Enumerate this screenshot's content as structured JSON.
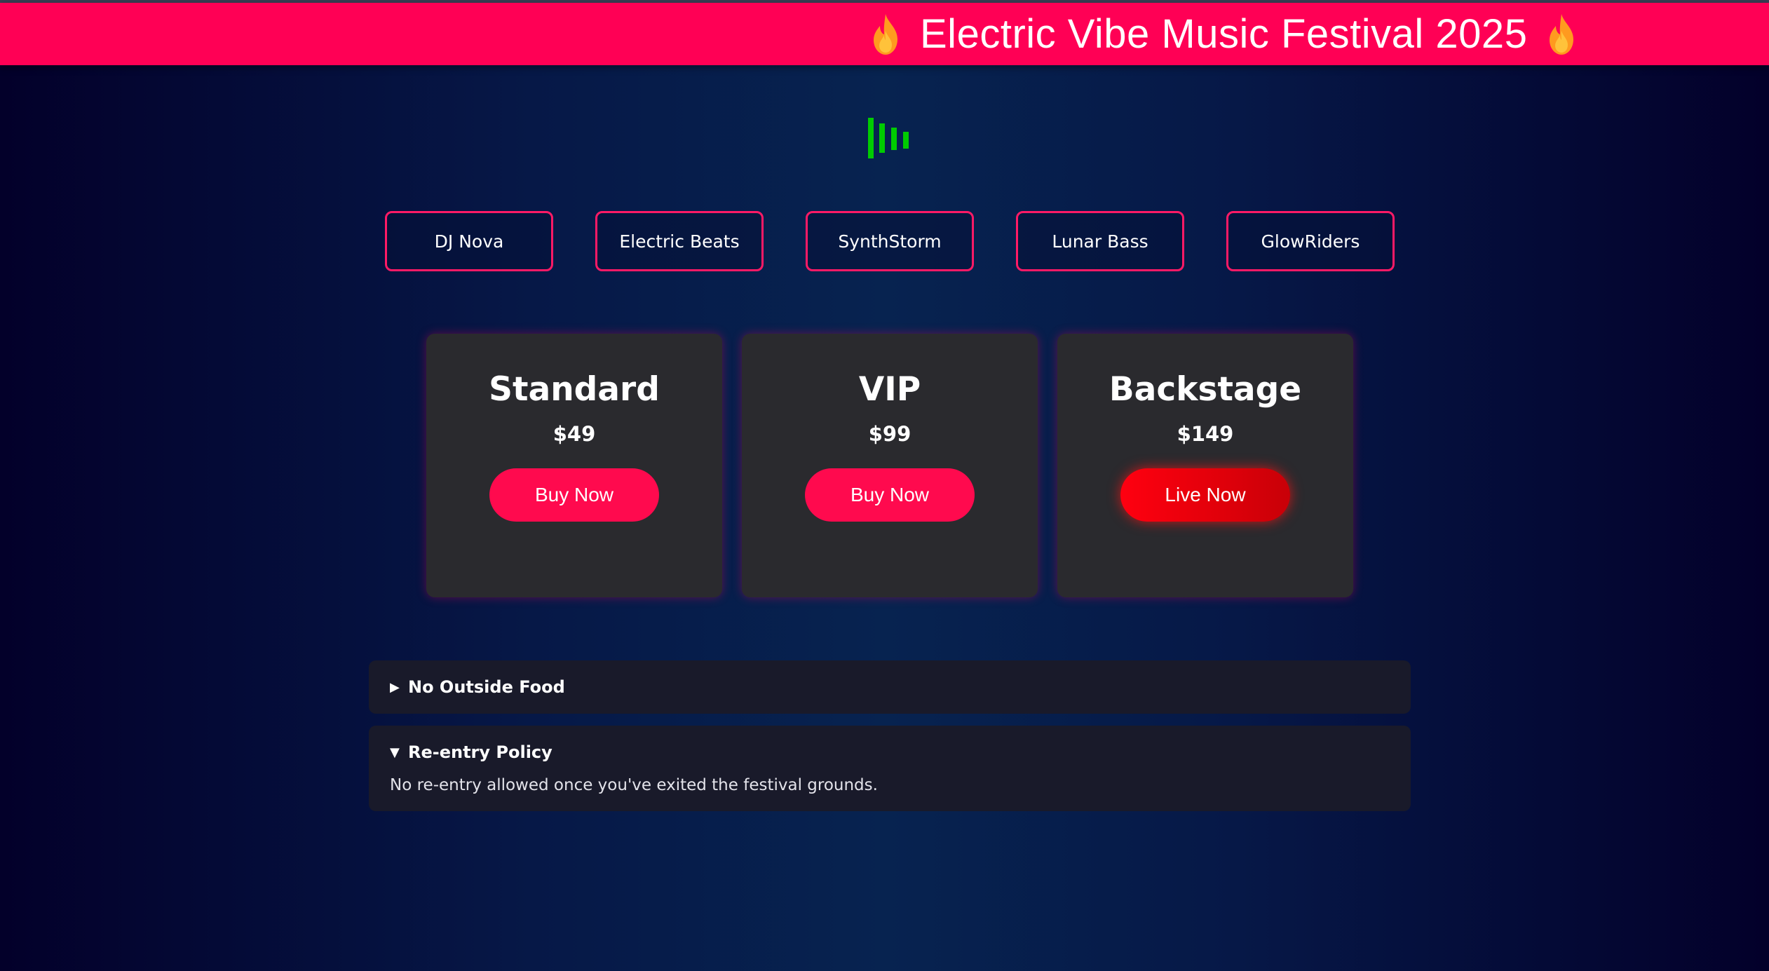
{
  "header": {
    "title": "Electric Vibe Music Festival 2025",
    "left_icon": "fire-icon",
    "right_icon": "fire-icon"
  },
  "visualizer": {
    "icon": "equalizer-icon",
    "color": "#00cc00"
  },
  "artists": [
    "DJ Nova",
    "Electric Beats",
    "SynthStorm",
    "Lunar Bass",
    "GlowRiders"
  ],
  "tickets": [
    {
      "name": "Standard",
      "price": "$49",
      "button": "Buy Now"
    },
    {
      "name": "VIP",
      "price": "$99",
      "button": "Buy Now"
    },
    {
      "name": "Backstage",
      "price": "$149",
      "button": "Live Now"
    }
  ],
  "faq": [
    {
      "title": "No Outside Food",
      "expanded": false,
      "arrow": "▶"
    },
    {
      "title": "Re-entry Policy",
      "expanded": true,
      "arrow": "▼",
      "body": "No re-entry allowed once you've exited the festival grounds."
    }
  ],
  "colors": {
    "accent": "#ff0055",
    "card": "#2a2a2e",
    "button": "#ff0a4e",
    "live_button": "#ff0010"
  }
}
